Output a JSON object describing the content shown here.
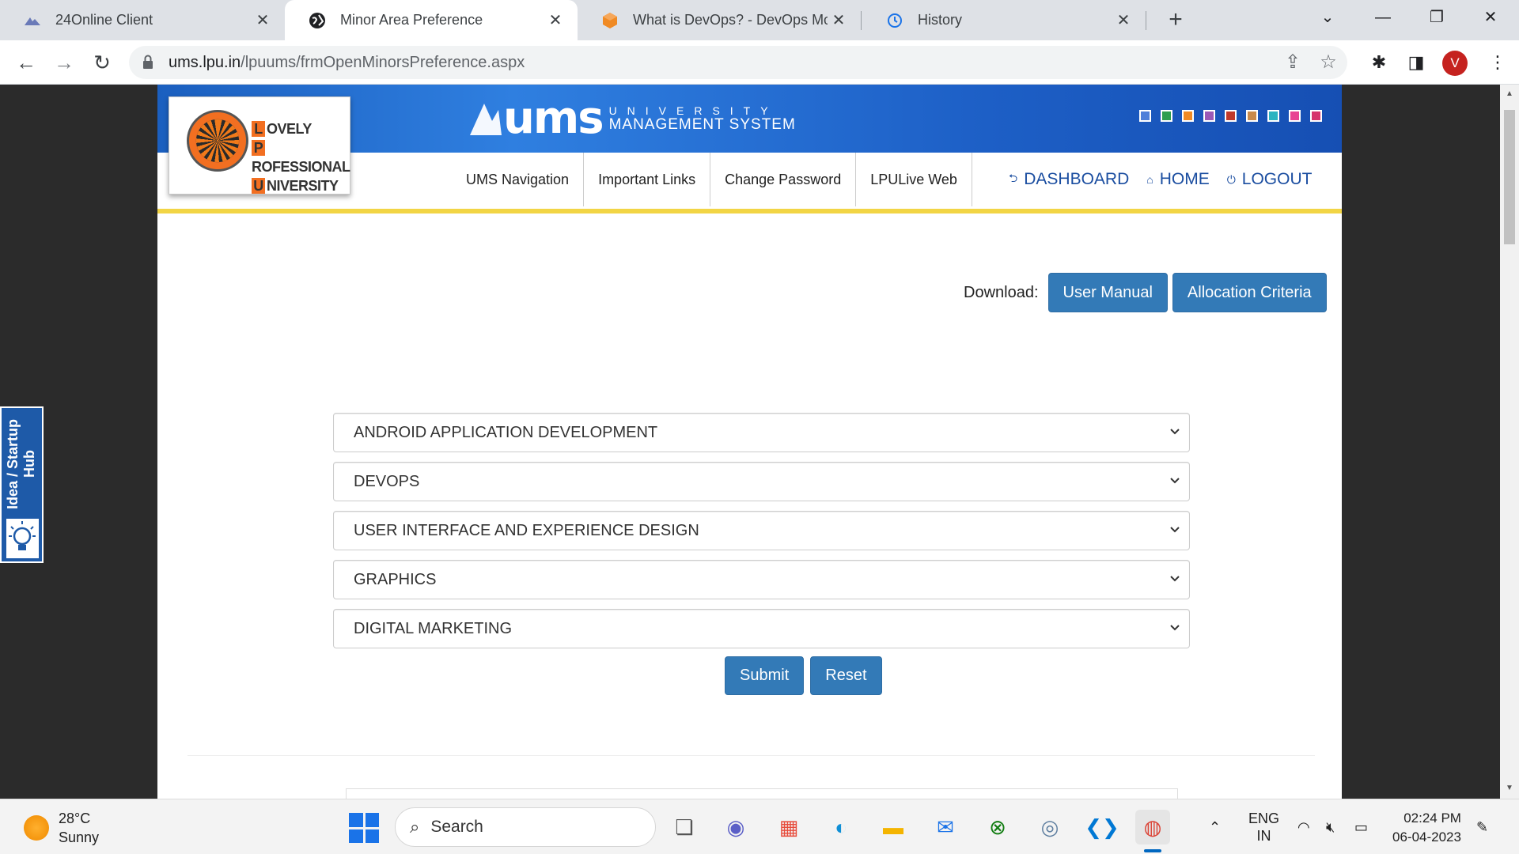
{
  "browser": {
    "tabs": [
      {
        "title": "24Online Client",
        "icon": "24online-icon",
        "active": false
      },
      {
        "title": "Minor Area Preference",
        "icon": "globe-icon",
        "active": true
      },
      {
        "title": "What is DevOps? - DevOps Mode",
        "icon": "cube-icon",
        "active": false
      },
      {
        "title": "History",
        "icon": "history-icon",
        "active": false
      }
    ],
    "url_host": "ums.lpu.in",
    "url_path": "/lpuums/frmOpenMinorsPreference.aspx",
    "profile_initial": "V"
  },
  "site": {
    "lpu_logo": {
      "l1": "OVELY",
      "l2": "ROFESSIONAL",
      "l3": "NIVERSITY",
      "c1": "L",
      "c2": "P",
      "c3": "U"
    },
    "ums_logo": {
      "big": "ums",
      "line1": "UNIVERSITY",
      "line2": "MANAGEMENT SYSTEM"
    },
    "theme_colors": [
      "#4f7fd9",
      "#2e9e4f",
      "#f08a24",
      "#9b59b6",
      "#c0392b",
      "#c98a4b",
      "#2bb3c0",
      "#e84393",
      "#d6336c"
    ],
    "nav": [
      "UMS Navigation",
      "Important Links",
      "Change Password",
      "LPULive Web"
    ],
    "nav_right": {
      "dashboard": "DASHBOARD",
      "home": "HOME",
      "logout": "LOGOUT"
    },
    "accent": "#337ab7"
  },
  "download": {
    "label": "Download:",
    "user_manual": "User Manual",
    "allocation_criteria": "Allocation Criteria"
  },
  "preferences": [
    "ANDROID APPLICATION DEVELOPMENT",
    "DEVOPS",
    "USER INTERFACE AND EXPERIENCE DESIGN",
    "GRAPHICS",
    "DIGITAL MARKETING"
  ],
  "actions": {
    "submit": "Submit",
    "reset": "Reset"
  },
  "idea_tab": "Idea / Startup Hub",
  "taskbar": {
    "weather_temp": "28°C",
    "weather_text": "Sunny",
    "search": "Search",
    "lang1": "ENG",
    "lang2": "IN",
    "time": "02:24 PM",
    "date": "06-04-2023"
  }
}
